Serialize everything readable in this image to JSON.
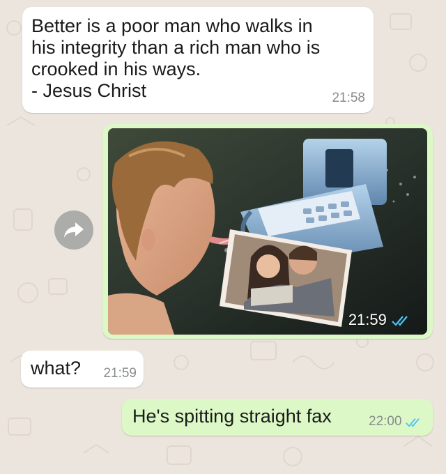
{
  "chat": {
    "messages": [
      {
        "direction": "incoming",
        "lines": [
          "Better is a poor man who walks in",
          "his integrity than a rich man who is",
          "crooked in his ways.",
          "- Jesus Christ"
        ],
        "time": "21:58"
      },
      {
        "direction": "outgoing",
        "type": "image",
        "image_description": "boy spitting toward a fax machine that prints a couple photo",
        "time": "21:59",
        "status": "read"
      },
      {
        "direction": "incoming",
        "text": "what?",
        "time": "21:59"
      },
      {
        "direction": "outgoing",
        "text": "He's spitting straight fax",
        "time": "22:00",
        "status": "read"
      }
    ]
  },
  "colors": {
    "chat_background": "#ece5dd",
    "incoming_bubble": "#ffffff",
    "outgoing_bubble": "#dcf8c6",
    "read_ticks": "#4fc3f7"
  },
  "icons": [
    "forward-icon",
    "double-check-icon"
  ]
}
